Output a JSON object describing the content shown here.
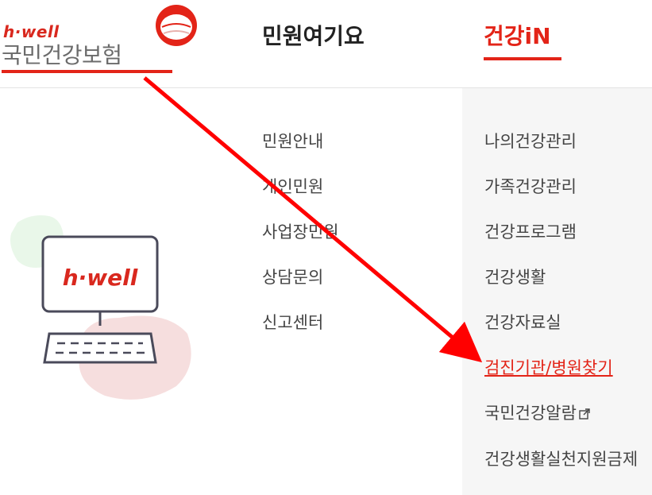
{
  "header": {
    "brand": "h·well",
    "org_name": "국민건강보험",
    "nav": [
      {
        "label": "민원여기요",
        "active": false
      },
      {
        "label": "건강iN",
        "active": true
      }
    ]
  },
  "menu_minwon": {
    "items": [
      "민원안내",
      "개인민원",
      "사업장민원",
      "상담문의",
      "신고센터"
    ]
  },
  "menu_health": {
    "items": [
      {
        "label": "나의건강관리"
      },
      {
        "label": "가족건강관리"
      },
      {
        "label": "건강프로그램"
      },
      {
        "label": "건강생활"
      },
      {
        "label": "건강자료실"
      },
      {
        "label": "검진기관/병원찾기",
        "active": true
      },
      {
        "label": "국민건강알람",
        "external_icon": "external-link-icon"
      },
      {
        "label": "건강생활실천지원금제"
      }
    ]
  },
  "illustration": {
    "screen_text": "h·well",
    "icon": "computer-icon"
  },
  "colors": {
    "accent": "#e32418",
    "panel_bg": "#f6f6f6",
    "text": "#444444",
    "logo_gray": "#6b6b6b"
  }
}
